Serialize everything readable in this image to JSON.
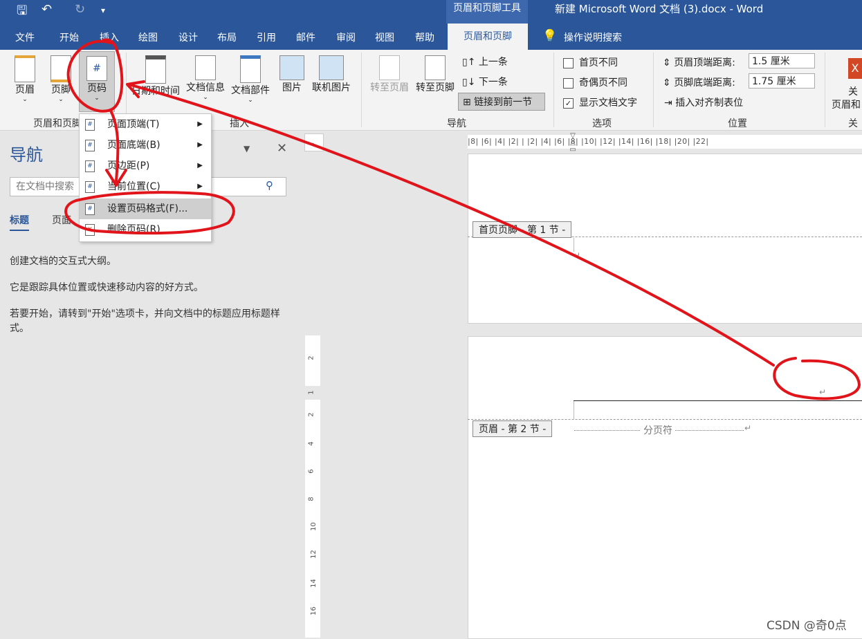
{
  "titlebar": {
    "context_tools": "页眉和页脚工具",
    "doc_title": "新建 Microsoft Word 文档 (3).docx  -  Word"
  },
  "tabs": [
    "文件",
    "开始",
    "插入",
    "绘图",
    "设计",
    "布局",
    "引用",
    "邮件",
    "审阅",
    "视图",
    "帮助"
  ],
  "active_tab": "页眉和页脚",
  "tell_me": "操作说明搜索",
  "ribbon": {
    "header": "页眉",
    "footer": "页脚",
    "page_number": "页码",
    "group_hf": "页眉和页脚",
    "datetime": "日期和时间",
    "docinfo": "文档信息",
    "docparts": "文档部件",
    "picture": "图片",
    "online_picture": "联机图片",
    "group_insert": "插入",
    "goto_header": "转至页眉",
    "goto_footer": "转至页脚",
    "prev": "上一条",
    "next": "下一条",
    "link_prev": "链接到前一节",
    "group_nav": "导航",
    "opt_first": "首页不同",
    "opt_oddeven": "奇偶页不同",
    "opt_showtext": "显示文档文字",
    "group_options": "选项",
    "header_dist_label": "页眉顶端距离:",
    "header_dist_value": "1.5 厘米",
    "footer_dist_label": "页脚底端距离:",
    "footer_dist_value": "1.75 厘米",
    "insert_align_tab": "插入对齐制表位",
    "group_position": "位置",
    "close_1": "关",
    "close_2": "页眉和",
    "close_group": "关"
  },
  "menu": {
    "items": [
      {
        "label": "页面顶端(T)",
        "arrow": "▶"
      },
      {
        "label": "页面底端(B)",
        "arrow": "▶"
      },
      {
        "label": "页边距(P)",
        "arrow": "▶"
      },
      {
        "label": "当前位置(C)",
        "arrow": "▶"
      },
      {
        "label": "设置页码格式(F)...",
        "arrow": ""
      },
      {
        "label": "删除页码(R)",
        "arrow": ""
      }
    ]
  },
  "nav": {
    "title": "导航",
    "search_placeholder": "在文档中搜索",
    "tab_headings": "标题",
    "tab_pages": "页面",
    "text1": "创建文档的交互式大纲。",
    "text2": "它是跟踪具体位置或快速移动内容的好方式。",
    "text3": "若要开始，请转到\"开始\"选项卡，并向文档中的标题应用标题样式。"
  },
  "doc": {
    "footer_tag": "首页页脚 - 第 1 节 -",
    "header_tag": "页眉 - 第 2 节 -",
    "page_break": "分页符",
    "para_mark": "↵"
  },
  "hruler_text": "|8| |6| |4| |2| | |2| |4| |6| |8| |10| |12| |14| |16| |18| |20| |22|",
  "vruler_nums": [
    "2",
    "1",
    "2",
    "4",
    "6",
    "8",
    "10",
    "12",
    "14",
    "16"
  ],
  "watermark": "CSDN @奇0点",
  "colors": {
    "accent": "#2b579a",
    "annotation": "#e0141a"
  }
}
